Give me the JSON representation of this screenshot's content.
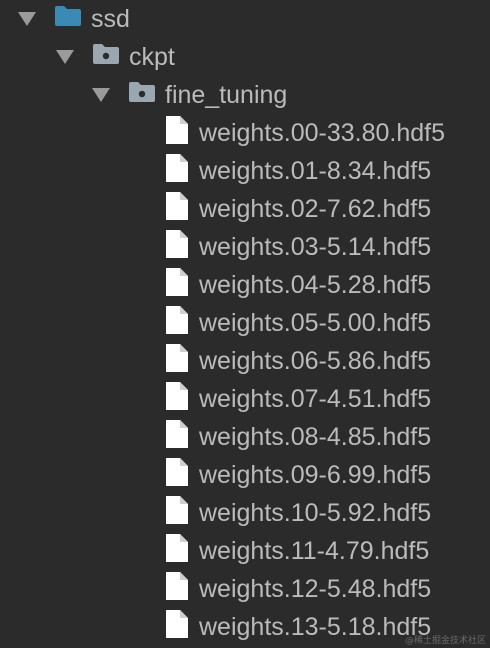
{
  "tree": {
    "root": {
      "label": "ssd",
      "expanded": true,
      "icon": "folder-icon",
      "color": "#3a8ab5"
    },
    "child": {
      "label": "ckpt",
      "expanded": true,
      "icon": "package-folder-icon",
      "color": "#9aa7b0"
    },
    "grandchild": {
      "label": "fine_tuning",
      "expanded": true,
      "icon": "package-folder-icon",
      "color": "#9aa7b0"
    },
    "files": [
      "weights.00-33.80.hdf5",
      "weights.01-8.34.hdf5",
      "weights.02-7.62.hdf5",
      "weights.03-5.14.hdf5",
      "weights.04-5.28.hdf5",
      "weights.05-5.00.hdf5",
      "weights.06-5.86.hdf5",
      "weights.07-4.51.hdf5",
      "weights.08-4.85.hdf5",
      "weights.09-6.99.hdf5",
      "weights.10-5.92.hdf5",
      "weights.11-4.79.hdf5",
      "weights.12-5.48.hdf5",
      "weights.13-5.18.hdf5"
    ],
    "file_icon": "file-icon"
  },
  "watermark": "@稀土掘金技术社区"
}
